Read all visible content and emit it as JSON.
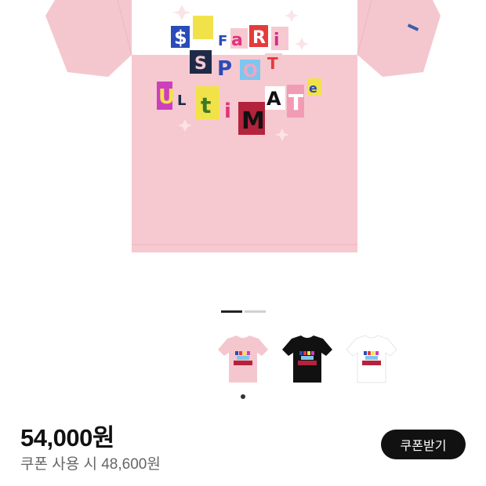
{
  "product": {
    "image_alt_colors": [
      "#f4c7cf",
      "#111111",
      "#ffffff"
    ],
    "graphic_lines": [
      "$AFARI",
      "SPOT",
      "ULTIMATE"
    ]
  },
  "gallery": {
    "pages_total": 2,
    "active_page": 1
  },
  "variants": [
    {
      "name": "pink",
      "color": "#f4c7cf"
    },
    {
      "name": "black",
      "color": "#111111"
    },
    {
      "name": "white",
      "color": "#ffffff"
    }
  ],
  "pricing": {
    "price": "54,000원",
    "coupon_price": "쿠폰 사용 시 48,600원",
    "coupon_button_label": "쿠폰받기"
  },
  "colors": {
    "shirt_pink": "#f4c7cf",
    "button_bg": "#111111"
  }
}
